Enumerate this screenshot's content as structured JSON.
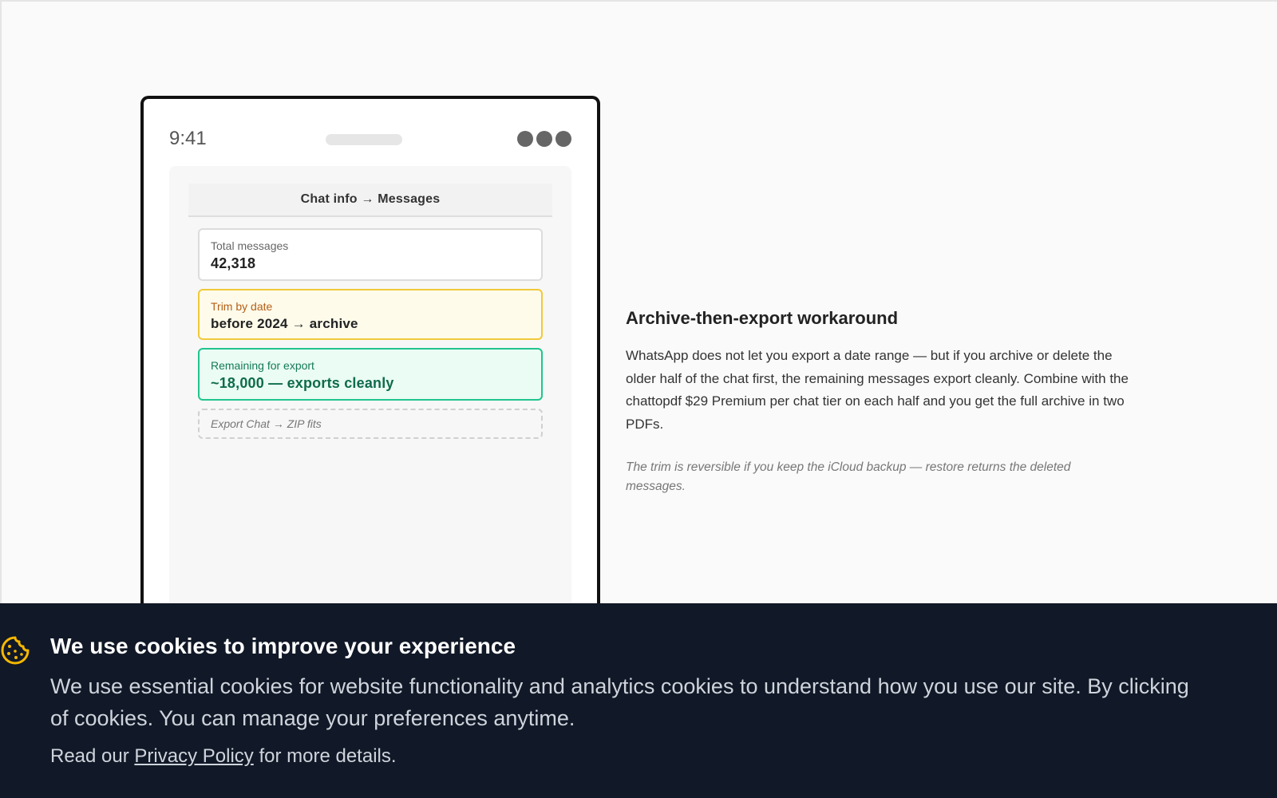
{
  "phone": {
    "status_time": "9:41",
    "screen_title": "Chat info → Messages",
    "cards": {
      "total": {
        "label": "Total messages",
        "value": "42,318"
      },
      "trim": {
        "label": "Trim by date",
        "value": "before 2024 → archive"
      },
      "remaining": {
        "label": "Remaining for export",
        "value": "~18,000 — exports cleanly"
      },
      "export": {
        "label": "Export Chat → ZIP fits"
      }
    }
  },
  "info": {
    "title": "Archive-then-export workaround",
    "body": "WhatsApp does not let you export a date range — but if you archive or delete the older half of the chat first, the remaining messages export cleanly. Combine with the chattopdf $29 Premium per chat tier on each half and you get the full archive in two PDFs.",
    "note": "The trim is reversible if you keep the iCloud backup — restore returns the deleted messages."
  },
  "cookie_banner": {
    "icon": "cookie-icon",
    "title": "We use cookies to improve your experience",
    "description_line1": "We use essential cookies for website functionality and analytics cookies to understand how you use our site. By clicking",
    "description_line2": "of cookies. You can manage your preferences anytime.",
    "read_prefix": "Read our",
    "privacy_link": "Privacy Policy",
    "read_suffix": "for more details."
  },
  "colors": {
    "banner_bg": "#111827",
    "cookie_icon": "#f5b800",
    "trim_border": "#f1c93a",
    "remaining_border": "#21c48e"
  }
}
